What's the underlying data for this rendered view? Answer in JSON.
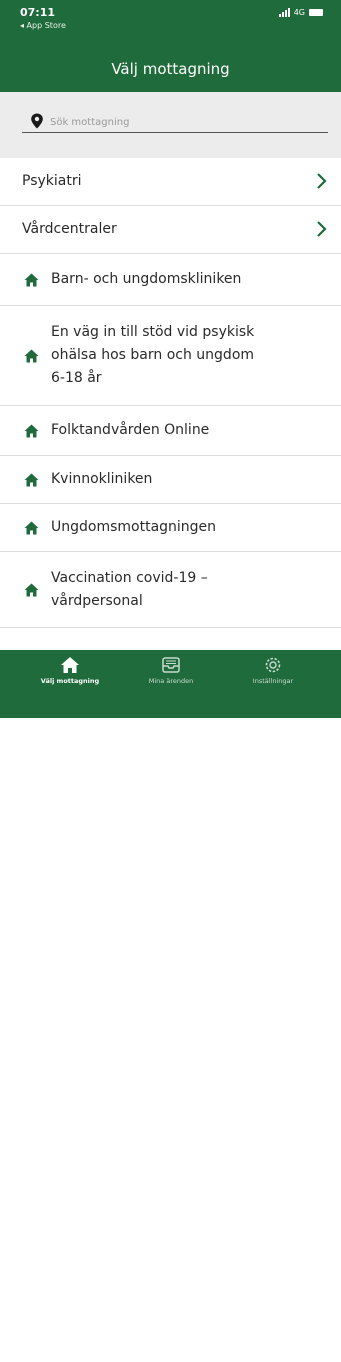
{
  "status_bar": {
    "time": "07:11",
    "back": "◂ App Store",
    "network": "4G"
  },
  "header": {
    "title": "Välj mottagning"
  },
  "search": {
    "placeholder": "Sök mottagning",
    "value": ""
  },
  "categories": [
    {
      "label": "Psykiatri"
    },
    {
      "label": "Vårdcentraler"
    }
  ],
  "clinics": [
    {
      "lines": [
        "Barn- och ungdomskliniken"
      ]
    },
    {
      "lines": [
        "En väg in till stöd vid psykisk",
        "ohälsa hos barn och ungdom",
        "6-18 år"
      ]
    },
    {
      "lines": [
        "Folktandvården Online"
      ]
    },
    {
      "lines": [
        "Kvinnokliniken"
      ]
    },
    {
      "lines": [
        "Ungdomsmottagningen"
      ]
    },
    {
      "lines": [
        "Vaccination covid-19 –",
        "vårdpersonal"
      ]
    }
  ],
  "tabbar": {
    "tabs": [
      {
        "label": "Välj mottagning",
        "icon": "home-icon",
        "active": true
      },
      {
        "label": "Mina ärenden",
        "icon": "inbox-icon",
        "active": false
      },
      {
        "label": "Inställningar",
        "icon": "gear-icon",
        "active": false
      }
    ]
  },
  "colors": {
    "brand": "#1f6b3b",
    "search_bg": "#ececec",
    "text": "#2a2a2a",
    "divider": "#dcdcdc"
  }
}
